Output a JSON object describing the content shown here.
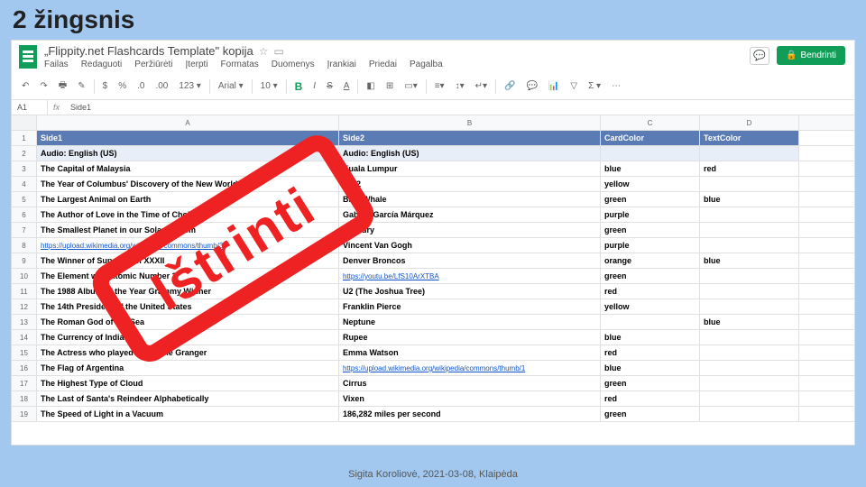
{
  "slide_title": "2 žingsnis",
  "doc_title": "„Flippity.net Flashcards Template\" kopija",
  "menus": [
    "Failas",
    "Redaguoti",
    "Peržiūrėti",
    "Įterpti",
    "Formatas",
    "Duomenys",
    "Įrankiai",
    "Priedai",
    "Pagalba"
  ],
  "share_label": "Bendrinti",
  "toolbar": {
    "currency": "$",
    "percent": "%",
    "dec": ".0",
    "inc": ".00",
    "zoom": "123",
    "font": "Arial",
    "size": "10"
  },
  "namebox": "A1",
  "fx_label": "fx",
  "fx_value": "Side1",
  "col_headers": [
    "A",
    "B",
    "C",
    "D"
  ],
  "row_numbers": [
    "1",
    "2",
    "3",
    "4",
    "5",
    "6",
    "7",
    "8",
    "9",
    "10",
    "11",
    "12",
    "13",
    "14",
    "15",
    "16",
    "17",
    "18",
    "19"
  ],
  "header_row": [
    "Side1",
    "Side2",
    "CardColor",
    "TextColor"
  ],
  "audio_row": [
    "Audio: English (US)",
    "Audio: English (US)",
    "",
    ""
  ],
  "rows": [
    {
      "a": "The Capital of Malaysia",
      "b": "Kuala Lumpur",
      "c": "blue",
      "d": "red"
    },
    {
      "a": "The Year of Columbus' Discovery of the New World",
      "b": "1492",
      "c": "yellow",
      "d": ""
    },
    {
      "a": "The Largest Animal on Earth",
      "b": "Blue Whale",
      "c": "green",
      "d": "blue"
    },
    {
      "a": "The Author of Love in the Time of Cholera",
      "b": "Gabriel García Márquez",
      "c": "purple",
      "d": ""
    },
    {
      "a": "The Smallest Planet in our Solar System",
      "b": "Mercury",
      "c": "green",
      "d": ""
    },
    {
      "a": "https://upload.wikimedia.org/wikipedia/commons/thumb/3",
      "b": "Vincent Van Gogh",
      "c": "purple",
      "d": ""
    },
    {
      "a": "The Winner of Super Bowl XXXII",
      "b": "Denver Broncos",
      "c": "orange",
      "d": "blue"
    },
    {
      "a": "The Element with Atomic Number 3",
      "b": "https://youtu.be/LfS10ArXTBA",
      "c": "green",
      "d": ""
    },
    {
      "a": "The 1988 Album of the Year Grammy Winner",
      "b": "U2 (The Joshua Tree)",
      "c": "red",
      "d": ""
    },
    {
      "a": "The 14th President of the United States",
      "b": "Franklin Pierce",
      "c": "yellow",
      "d": ""
    },
    {
      "a": "The Roman God of the Sea",
      "b": "Neptune",
      "c": "",
      "d": "blue"
    },
    {
      "a": "The Currency of India",
      "b": "Rupee",
      "c": "blue",
      "d": ""
    },
    {
      "a": "The Actress who played Hermione Granger",
      "b": "Emma Watson",
      "c": "red",
      "d": ""
    },
    {
      "a": "The Flag of Argentina",
      "b": "https://upload.wikimedia.org/wikipedia/commons/thumb/1",
      "c": "blue",
      "d": ""
    },
    {
      "a": "The Highest Type of Cloud",
      "b": "Cirrus",
      "c": "green",
      "d": ""
    },
    {
      "a": "The Last of Santa's Reindeer Alphabetically",
      "b": "Vixen",
      "c": "red",
      "d": ""
    },
    {
      "a": "The Speed of Light in a Vacuum",
      "b": "186,282 miles per second",
      "c": "green",
      "d": ""
    }
  ],
  "link_rows_a": [
    5
  ],
  "link_rows_b": [
    7,
    13
  ],
  "stamp_text": "Ištrinti",
  "footer": "Sigita Koroliovė, 2021-03-08, Klaipėda"
}
